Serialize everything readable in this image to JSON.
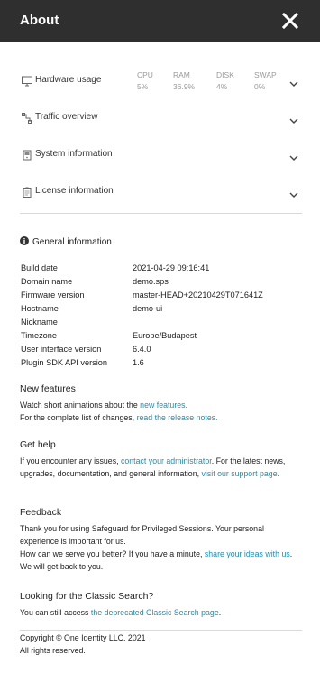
{
  "header": {
    "title": "About"
  },
  "sections": [
    {
      "label": "Hardware usage",
      "icon": "monitor-icon"
    },
    {
      "label": "Traffic overview",
      "icon": "traffic-icon"
    },
    {
      "label": "System information",
      "icon": "server-icon"
    },
    {
      "label": "License information",
      "icon": "license-icon"
    }
  ],
  "hardware": {
    "cpu_label": "CPU",
    "cpu_value": "5%",
    "ram_label": "RAM",
    "ram_value": "36.9%",
    "disk_label": "DISK",
    "disk_value": "4%",
    "swap_label": "SWAP",
    "swap_value": "0%"
  },
  "general": {
    "title": "General information",
    "rows": [
      {
        "key": "Build date",
        "value": "2021-04-29 09:16:41"
      },
      {
        "key": "Domain name",
        "value": "demo.sps"
      },
      {
        "key": "Firmware version",
        "value": "master-HEAD+20210429T071641Z"
      },
      {
        "key": "Hostname",
        "value": "demo-ui"
      },
      {
        "key": "Nickname",
        "value": ""
      },
      {
        "key": "Timezone",
        "value": "Europe/Budapest"
      },
      {
        "key": "User interface version",
        "value": "6.4.0"
      },
      {
        "key": "Plugin SDK API version",
        "value": "1.6"
      }
    ]
  },
  "new_features": {
    "title": "New features",
    "line1_pre": "Watch short animations about the ",
    "line1_link": "new features.",
    "line2_pre": "For the complete list of changes, ",
    "line2_link": "read the release notes."
  },
  "get_help": {
    "title": "Get help",
    "pre": "If you encounter any issues, ",
    "link1": "contact your administrator",
    "mid": ". For the latest news, upgrades, documentation, and general information, ",
    "link2": "visit our support page",
    "post": "."
  },
  "feedback": {
    "title": "Feedback",
    "text1": "Thank you for using Safeguard for Privileged Sessions. Your personal experience is important for us.",
    "pre": "How can we serve you better? If you have a minute, ",
    "link": "share your ideas with us",
    "post": ". We will get back to you."
  },
  "classic": {
    "title": "Looking for the Classic Search?",
    "pre": "You can still access ",
    "link": "the deprecated Classic Search page",
    "post": "."
  },
  "footer": {
    "copyright": "Copyright © One Identity LLC. 2021",
    "rights": "All rights reserved."
  }
}
